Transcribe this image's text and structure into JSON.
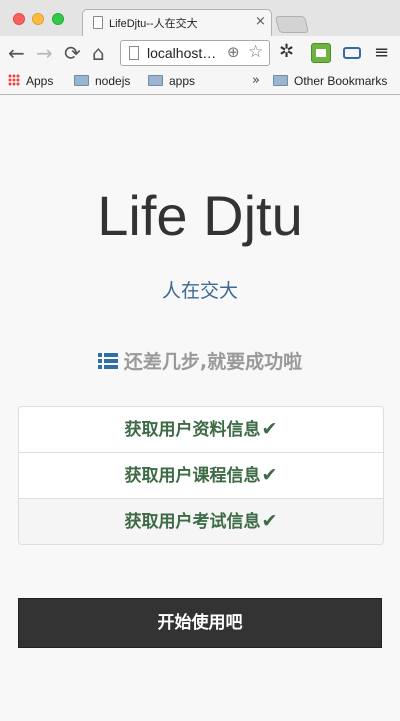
{
  "browser": {
    "tab_title": "LifeDjtu--人在交大",
    "tab_close": "×",
    "nav": {
      "back": "←",
      "forward": "→",
      "reload": "⟳",
      "home": "⌂"
    },
    "url": "localhost…",
    "menu_glyph": "≡",
    "bookmarks": [
      {
        "label": "Apps",
        "icon": "apps-grid-icon"
      },
      {
        "label": "nodejs",
        "icon": "folder-icon"
      },
      {
        "label": "apps",
        "icon": "folder-icon"
      }
    ],
    "overflow": "»",
    "other_bookmarks": "Other Bookmarks"
  },
  "page": {
    "title": "Life Djtu",
    "subtitle": "人在交大",
    "status": "还差几步,就要成功啦",
    "steps": [
      {
        "label": "获取用户资料信息",
        "done": true
      },
      {
        "label": "获取用户课程信息",
        "done": true
      },
      {
        "label": "获取用户考试信息",
        "done": true
      }
    ],
    "check_glyph": "✔",
    "start_button": "开始使用吧"
  },
  "colors": {
    "accent_blue": "#3a6a94",
    "success_green": "#3d6b46",
    "button_dark": "#333333",
    "status_grey": "#999999"
  }
}
